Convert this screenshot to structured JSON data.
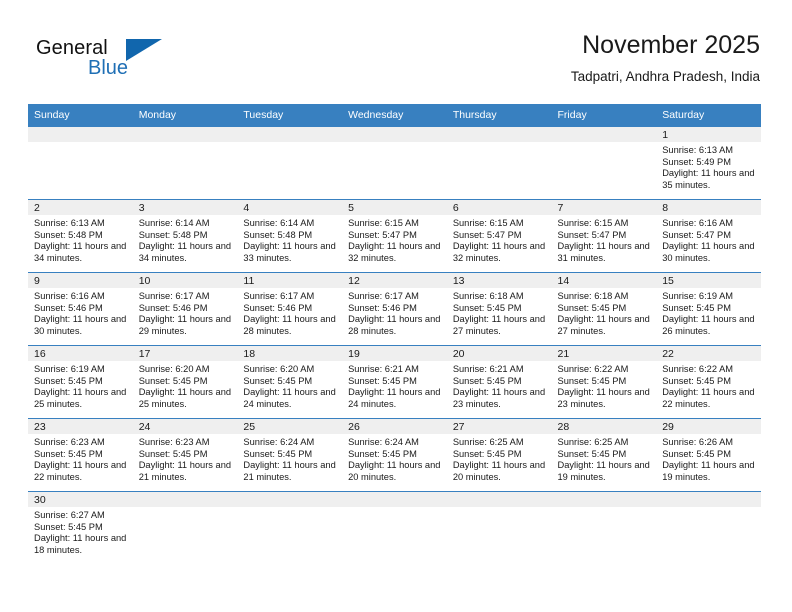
{
  "brand": {
    "name_part1": "General",
    "name_part2": "Blue",
    "triangle_color": "#1166ad",
    "blue_color": "#1f6fb5"
  },
  "header": {
    "title": "November 2025",
    "subtitle": "Tadpatri, Andhra Pradesh, India"
  },
  "theme": {
    "header_row_bg": "#3880c0",
    "header_row_text": "#ffffff",
    "daynum_band_bg": "#efefef",
    "row_separator": "#3880c0",
    "text": "#1a1a1a"
  },
  "calendar": {
    "weekday_headers": [
      "Sunday",
      "Monday",
      "Tuesday",
      "Wednesday",
      "Thursday",
      "Friday",
      "Saturday"
    ],
    "weeks": [
      [
        {
          "day": "",
          "empty": true
        },
        {
          "day": "",
          "empty": true
        },
        {
          "day": "",
          "empty": true
        },
        {
          "day": "",
          "empty": true
        },
        {
          "day": "",
          "empty": true
        },
        {
          "day": "",
          "empty": true
        },
        {
          "day": "1",
          "sunrise": "Sunrise: 6:13 AM",
          "sunset": "Sunset: 5:49 PM",
          "daylight": "Daylight: 11 hours and 35 minutes."
        }
      ],
      [
        {
          "day": "2",
          "sunrise": "Sunrise: 6:13 AM",
          "sunset": "Sunset: 5:48 PM",
          "daylight": "Daylight: 11 hours and 34 minutes."
        },
        {
          "day": "3",
          "sunrise": "Sunrise: 6:14 AM",
          "sunset": "Sunset: 5:48 PM",
          "daylight": "Daylight: 11 hours and 34 minutes."
        },
        {
          "day": "4",
          "sunrise": "Sunrise: 6:14 AM",
          "sunset": "Sunset: 5:48 PM",
          "daylight": "Daylight: 11 hours and 33 minutes."
        },
        {
          "day": "5",
          "sunrise": "Sunrise: 6:15 AM",
          "sunset": "Sunset: 5:47 PM",
          "daylight": "Daylight: 11 hours and 32 minutes."
        },
        {
          "day": "6",
          "sunrise": "Sunrise: 6:15 AM",
          "sunset": "Sunset: 5:47 PM",
          "daylight": "Daylight: 11 hours and 32 minutes."
        },
        {
          "day": "7",
          "sunrise": "Sunrise: 6:15 AM",
          "sunset": "Sunset: 5:47 PM",
          "daylight": "Daylight: 11 hours and 31 minutes."
        },
        {
          "day": "8",
          "sunrise": "Sunrise: 6:16 AM",
          "sunset": "Sunset: 5:47 PM",
          "daylight": "Daylight: 11 hours and 30 minutes."
        }
      ],
      [
        {
          "day": "9",
          "sunrise": "Sunrise: 6:16 AM",
          "sunset": "Sunset: 5:46 PM",
          "daylight": "Daylight: 11 hours and 30 minutes."
        },
        {
          "day": "10",
          "sunrise": "Sunrise: 6:17 AM",
          "sunset": "Sunset: 5:46 PM",
          "daylight": "Daylight: 11 hours and 29 minutes."
        },
        {
          "day": "11",
          "sunrise": "Sunrise: 6:17 AM",
          "sunset": "Sunset: 5:46 PM",
          "daylight": "Daylight: 11 hours and 28 minutes."
        },
        {
          "day": "12",
          "sunrise": "Sunrise: 6:17 AM",
          "sunset": "Sunset: 5:46 PM",
          "daylight": "Daylight: 11 hours and 28 minutes."
        },
        {
          "day": "13",
          "sunrise": "Sunrise: 6:18 AM",
          "sunset": "Sunset: 5:45 PM",
          "daylight": "Daylight: 11 hours and 27 minutes."
        },
        {
          "day": "14",
          "sunrise": "Sunrise: 6:18 AM",
          "sunset": "Sunset: 5:45 PM",
          "daylight": "Daylight: 11 hours and 27 minutes."
        },
        {
          "day": "15",
          "sunrise": "Sunrise: 6:19 AM",
          "sunset": "Sunset: 5:45 PM",
          "daylight": "Daylight: 11 hours and 26 minutes."
        }
      ],
      [
        {
          "day": "16",
          "sunrise": "Sunrise: 6:19 AM",
          "sunset": "Sunset: 5:45 PM",
          "daylight": "Daylight: 11 hours and 25 minutes."
        },
        {
          "day": "17",
          "sunrise": "Sunrise: 6:20 AM",
          "sunset": "Sunset: 5:45 PM",
          "daylight": "Daylight: 11 hours and 25 minutes."
        },
        {
          "day": "18",
          "sunrise": "Sunrise: 6:20 AM",
          "sunset": "Sunset: 5:45 PM",
          "daylight": "Daylight: 11 hours and 24 minutes."
        },
        {
          "day": "19",
          "sunrise": "Sunrise: 6:21 AM",
          "sunset": "Sunset: 5:45 PM",
          "daylight": "Daylight: 11 hours and 24 minutes."
        },
        {
          "day": "20",
          "sunrise": "Sunrise: 6:21 AM",
          "sunset": "Sunset: 5:45 PM",
          "daylight": "Daylight: 11 hours and 23 minutes."
        },
        {
          "day": "21",
          "sunrise": "Sunrise: 6:22 AM",
          "sunset": "Sunset: 5:45 PM",
          "daylight": "Daylight: 11 hours and 23 minutes."
        },
        {
          "day": "22",
          "sunrise": "Sunrise: 6:22 AM",
          "sunset": "Sunset: 5:45 PM",
          "daylight": "Daylight: 11 hours and 22 minutes."
        }
      ],
      [
        {
          "day": "23",
          "sunrise": "Sunrise: 6:23 AM",
          "sunset": "Sunset: 5:45 PM",
          "daylight": "Daylight: 11 hours and 22 minutes."
        },
        {
          "day": "24",
          "sunrise": "Sunrise: 6:23 AM",
          "sunset": "Sunset: 5:45 PM",
          "daylight": "Daylight: 11 hours and 21 minutes."
        },
        {
          "day": "25",
          "sunrise": "Sunrise: 6:24 AM",
          "sunset": "Sunset: 5:45 PM",
          "daylight": "Daylight: 11 hours and 21 minutes."
        },
        {
          "day": "26",
          "sunrise": "Sunrise: 6:24 AM",
          "sunset": "Sunset: 5:45 PM",
          "daylight": "Daylight: 11 hours and 20 minutes."
        },
        {
          "day": "27",
          "sunrise": "Sunrise: 6:25 AM",
          "sunset": "Sunset: 5:45 PM",
          "daylight": "Daylight: 11 hours and 20 minutes."
        },
        {
          "day": "28",
          "sunrise": "Sunrise: 6:25 AM",
          "sunset": "Sunset: 5:45 PM",
          "daylight": "Daylight: 11 hours and 19 minutes."
        },
        {
          "day": "29",
          "sunrise": "Sunrise: 6:26 AM",
          "sunset": "Sunset: 5:45 PM",
          "daylight": "Daylight: 11 hours and 19 minutes."
        }
      ],
      [
        {
          "day": "30",
          "sunrise": "Sunrise: 6:27 AM",
          "sunset": "Sunset: 5:45 PM",
          "daylight": "Daylight: 11 hours and 18 minutes."
        },
        {
          "day": "",
          "empty": true
        },
        {
          "day": "",
          "empty": true
        },
        {
          "day": "",
          "empty": true
        },
        {
          "day": "",
          "empty": true
        },
        {
          "day": "",
          "empty": true
        },
        {
          "day": "",
          "empty": true
        }
      ]
    ]
  }
}
